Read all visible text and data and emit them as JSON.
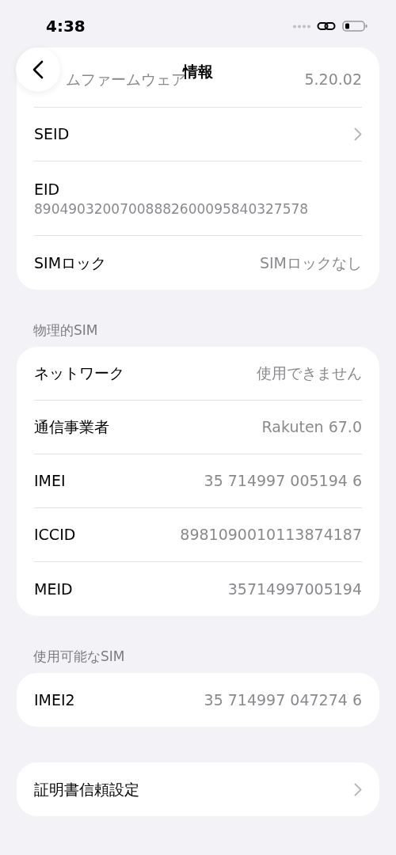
{
  "status_bar": {
    "time": "4:38"
  },
  "nav": {
    "title": "情報"
  },
  "top_card": {
    "faded_row": {
      "label": "ムファームウェア",
      "value": "5.20.02"
    },
    "rows": [
      {
        "kind": "link",
        "label": "SEID"
      },
      {
        "kind": "stacked",
        "label": "EID",
        "value": "89049032007008882600095840327578"
      },
      {
        "kind": "value",
        "label": "SIMロック",
        "value": "SIMロックなし"
      }
    ]
  },
  "sections": [
    {
      "header": "物理的SIM",
      "rows": [
        {
          "kind": "value",
          "label": "ネットワーク",
          "value": "使用できません"
        },
        {
          "kind": "value",
          "label": "通信事業者",
          "value": "Rakuten 67.0"
        },
        {
          "kind": "value",
          "label": "IMEI",
          "value": "35 714997 005194 6"
        },
        {
          "kind": "value",
          "label": "ICCID",
          "value": "8981090010113874187"
        },
        {
          "kind": "value",
          "label": "MEID",
          "value": "35714997005194"
        }
      ]
    },
    {
      "header": "使用可能なSIM",
      "rows": [
        {
          "kind": "value",
          "label": "IMEI2",
          "value": "35 714997 047274 6"
        }
      ]
    },
    {
      "rows": [
        {
          "kind": "link",
          "label": "証明書信頼設定"
        }
      ]
    }
  ]
}
